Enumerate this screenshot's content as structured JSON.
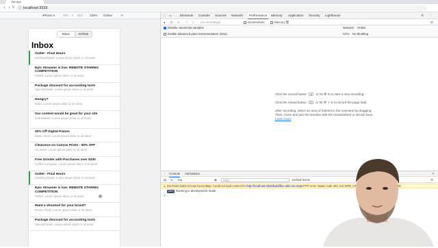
{
  "browser": {
    "tab_title": "Vite App",
    "url": "localhost:3333"
  },
  "device_toolbar": {
    "device": "iPhone X",
    "width": "375",
    "times": "x",
    "height": "812",
    "zoom": "100%",
    "throttle": "Online"
  },
  "app": {
    "segment": [
      "Inbox",
      "Archive"
    ],
    "title": "Inbox",
    "messages": [
      {
        "title": "Outlet - Final Hours",
        "sub": "Clothing Brand: Lorum ipsum dolor or sit amet",
        "unread": true
      },
      {
        "title": "Epic Streamer is live: REMOTE STARING COMPETITION",
        "sub": "Twitch: Lorum ipsum dolor or sit amet",
        "unread": false
      },
      {
        "title": "Package discount for accounting tools",
        "sub": "Special Deals: Lorum ipsum dolor or sit amet",
        "unread": false
      },
      {
        "title": "Hungry?",
        "sub": "Evan: Lorum ipsum dolor or sit amet",
        "unread": false
      },
      {
        "title": "Our content would be great for your site",
        "sub": "Link Builder: Lorum ipsum dolor or sit amet",
        "unread": false
      },
      {
        "title": "20% Off Digital Pianos",
        "sub": "Music Store: Lorum ipsum dolor or sit amet",
        "unread": false
      },
      {
        "title": "Clearance on Canvas Prints - 50% OFF",
        "sub": "Art Store: Lorum ipsum dolor or sit amet",
        "unread": false
      },
      {
        "title": "Free Grinder with Purchases over $200",
        "sub": "Coffee Company: Lorum ipsum dolor or sit amet",
        "unread": false
      },
      {
        "title": "Outlet - Final Hours",
        "sub": "Clothing Brand: Lorum ipsum dolor or sit amet",
        "unread": true
      },
      {
        "title": "Epic Streamer is live: REMOTE STARING COMPETITION",
        "sub": "Twitch: Lorum ipsum dolor or sit amet",
        "unread": false
      },
      {
        "title": "Want a shoutout for your brand?",
        "sub": "Promo Tools: Lorum ipsum dolor or sit amet",
        "unread": false
      },
      {
        "title": "Package discount for accounting tools",
        "sub": "Special Deals: Lorum ipsum dolor or sit amet",
        "unread": false
      }
    ]
  },
  "devtools": {
    "tabs": [
      "Elements",
      "Console",
      "Sources",
      "Network",
      "Performance",
      "Memory",
      "Application",
      "Security",
      "Lighthouse"
    ],
    "selected_tab": "Performance",
    "toolbar": {
      "recording": "(no recordings)",
      "screenshots": "Screenshots",
      "memory": "Memory"
    },
    "settings": {
      "disable_js_samples": "Disable JavaScript samples",
      "advanced_paint": "Enable advanced paint instrumentation (slow)",
      "network_label": "Network:",
      "network_value": "Online",
      "cpu_label": "CPU:",
      "cpu_value": "No throttling"
    },
    "hints": {
      "record_pre": "Click the record button",
      "record_post": "or hit ⌘ E to start a new recording.",
      "reload_pre": "Click the reload button",
      "reload_post": "or hit ⌘ ⇧ E to record the page load.",
      "after1": "After recording, select an area of interest in the overview by dragging.",
      "after2": "Then, zoom and pan the timeline with the mousewheel or WASD keys.",
      "learn_more": "Learn more"
    },
    "drawer": {
      "tabs": [
        "Console",
        "Animations"
      ],
      "context": "top",
      "filter_placeholder": "Filter",
      "levels": "Default levels",
      "error_prefix": "DevTools failed to load SourceMap: Could not load content for ",
      "error_link": "http://localhost:3333/build/flex-utils.css.map",
      "error_suffix": "HTTP error: status code 404, net::ERR_HTTP_RESPONSE_CODE_FAILURE",
      "log_badge": "[vite]",
      "log_text": "Running in development mode.",
      "prompt": ">"
    }
  },
  "colors": {
    "unread_accent": "#2e9d4f",
    "devtools_link": "#1a73e8"
  }
}
